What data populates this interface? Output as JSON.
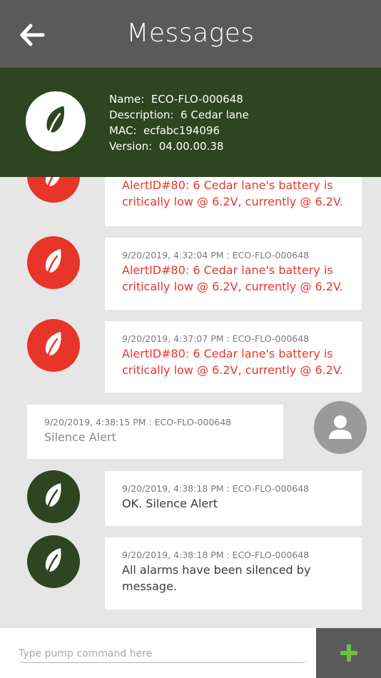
{
  "header": {
    "title": "Messages",
    "back_icon": "arrow-left-icon"
  },
  "device": {
    "logo_icon": "leaf-icon",
    "name_label": "Name:",
    "name_value": "ECO-FLO-000648",
    "description_label": "Description:",
    "description_value": "6 Cedar lane",
    "mac_label": "MAC:",
    "mac_value": "ecfabc194096",
    "version_label": "Version:",
    "version_value": "04.00.00.38"
  },
  "messages": [
    {
      "meta": "",
      "text_line1": "AlertID#80: 6 Cedar lane's battery is",
      "text_line2": "critically low @ 6.2V, currently @ 6.2V."
    },
    {
      "meta": "9/20/2019, 4:32:04 PM : ECO-FLO-000648",
      "text_line1": "AlertID#80: 6 Cedar lane's battery is",
      "text_line2": "critically low @ 6.2V, currently @ 6.2V."
    },
    {
      "meta": "9/20/2019, 4:37:07 PM : ECO-FLO-000648",
      "text_line1": "AlertID#80: 6 Cedar lane's battery is",
      "text_line2": "critically low @ 6.2V, currently @ 6.2V."
    },
    {
      "meta": "9/20/2019, 4:38:15 PM : ECO-FLO-000648",
      "text_line1": "Silence Alert"
    },
    {
      "meta": "9/20/2019, 4:38:18 PM : ECO-FLO-000648",
      "text_line1": "OK. Silence Alert"
    },
    {
      "meta": "9/20/2019, 4:38:18 PM : ECO-FLO-000648",
      "text_line1": "All alarms have been silenced by",
      "text_line2": "message."
    }
  ],
  "composer": {
    "placeholder": "Type pump command here",
    "value": "",
    "add_icon": "plus-icon"
  },
  "colors": {
    "header_bg": "#5a5a5a",
    "device_panel_bg": "#2f4420",
    "alert_red": "#e8352a",
    "accent_green": "#6cc04a",
    "background": "#e6e6e6"
  }
}
